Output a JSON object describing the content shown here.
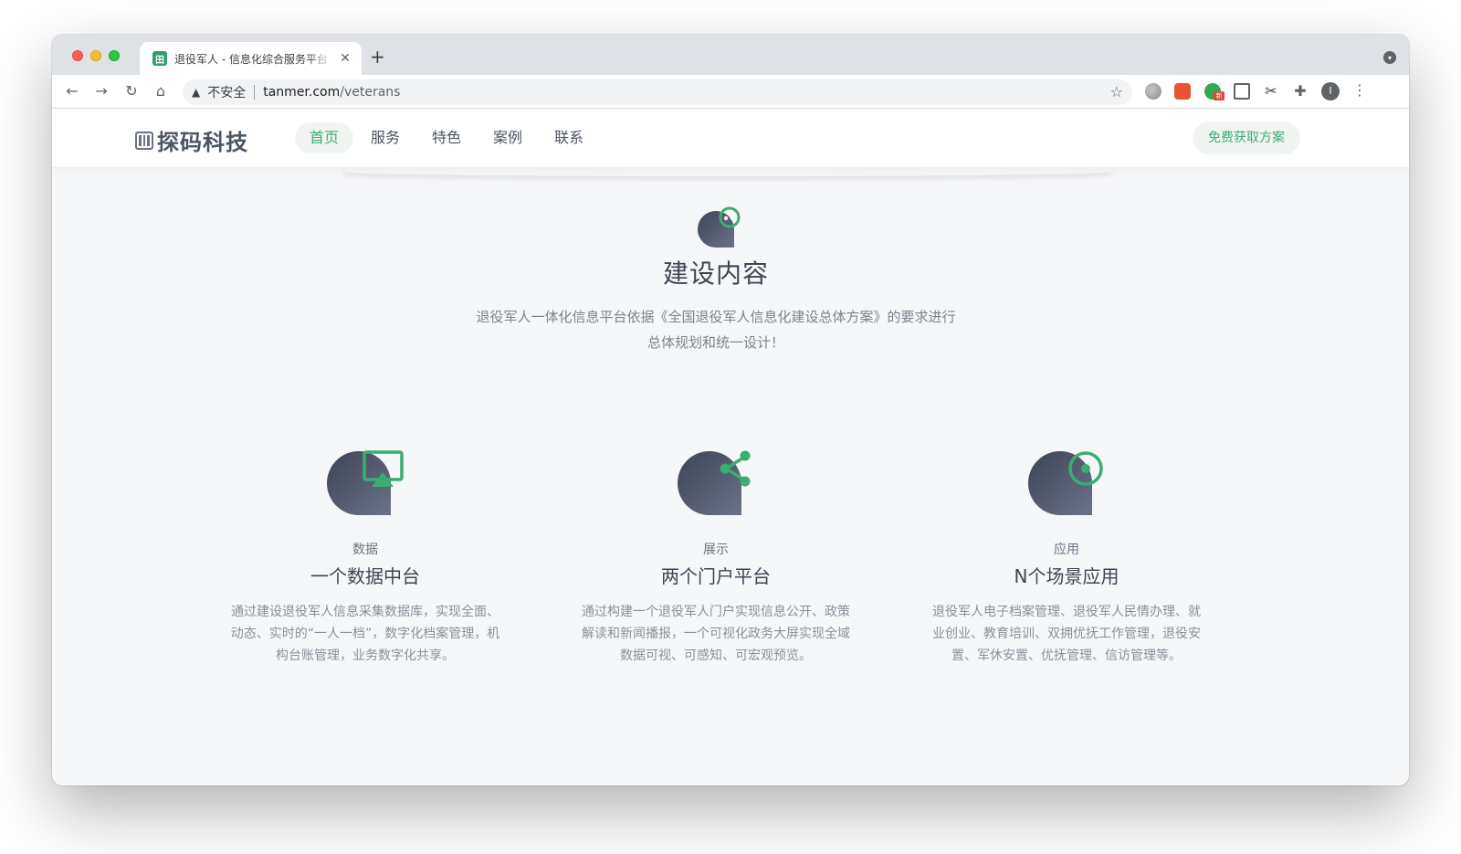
{
  "browser": {
    "tab_title": "退役军人 - 信息化综合服务平台 |",
    "tab_favicon": "田",
    "tab_close": "✕",
    "new_tab": "+",
    "security_label": "不安全",
    "url_host": "tanmer.com",
    "url_path": "/veterans",
    "avatar_letter": "I",
    "ext_badge": "新",
    "icons": [
      "back-icon",
      "forward-icon",
      "reload-icon",
      "home-icon",
      "warning-icon",
      "star-icon",
      "globe-icon",
      "book-icon",
      "grammar-icon",
      "screenshot-icon",
      "scissors-icon",
      "puzzle-icon",
      "more-icon"
    ]
  },
  "site": {
    "logo_text": "探码科技",
    "nav": [
      {
        "label": "首页",
        "active": true
      },
      {
        "label": "服务",
        "active": false
      },
      {
        "label": "特色",
        "active": false
      },
      {
        "label": "案例",
        "active": false
      },
      {
        "label": "联系",
        "active": false
      }
    ],
    "cta_label": "免费获取方案"
  },
  "section": {
    "title": "建设内容",
    "description": "退役军人一体化信息平台依据《全国退役军人信息化建设总体方案》的要求进行总体规划和统一设计！"
  },
  "features": [
    {
      "tag": "数据",
      "title": "一个数据中台",
      "desc": "通过建设退役军人信息采集数据库，实现全面、动态、实时的“一人一档”，数字化档案管理，机构台账管理，业务数字化共享。",
      "icon": "screen-cast-icon"
    },
    {
      "tag": "展示",
      "title": "两个门户平台",
      "desc": "通过构建一个退役军人门户实现信息公开、政策解读和新闻播报，一个可视化政务大屏实现全域数据可视、可感知、可宏观预览。",
      "icon": "share-icon"
    },
    {
      "tag": "应用",
      "title": "N个场景应用",
      "desc": "退役军人电子档案管理、退役军人民情办理、就业创业、教育培训、双拥优抚工作管理，退役安置、军休安置、优抚管理、信访管理等。",
      "icon": "target-icon"
    }
  ],
  "colors": {
    "accent": "#3aad73",
    "icon_dark": "#4a5163",
    "text_dark": "#3f4553",
    "text_muted": "#8a8f99"
  }
}
